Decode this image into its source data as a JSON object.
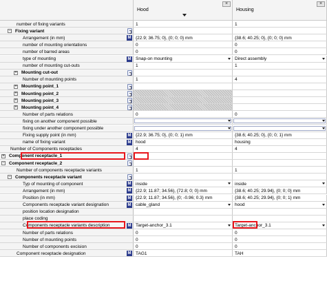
{
  "columns": [
    {
      "title": "Hood",
      "close": "×"
    },
    {
      "title": "Housing",
      "close": "×"
    }
  ],
  "rows": [
    {
      "label": "number of fixing variants",
      "indent": 1,
      "bold": false,
      "toggle": "",
      "icon": "",
      "hood": "1",
      "housing": "1",
      "hood_dd": false,
      "housing_dd": false
    },
    {
      "label": "Fixing variant",
      "indent": 1,
      "bold": true,
      "toggle": "−",
      "icon": "link",
      "hood": "",
      "housing": "",
      "hood_dd": false,
      "housing_dd": false
    },
    {
      "label": "Arrangement (in mm)",
      "indent": 2,
      "bold": false,
      "toggle": "",
      "icon": "M",
      "hood": "{22.9; 36.75; 0}, {0; 0; 0} mm",
      "housing": "{38.6; 40.25; 0}, {0; 0; 0} mm",
      "hood_dd": false,
      "housing_dd": false
    },
    {
      "label": "number of mounting orientations",
      "indent": 2,
      "bold": false,
      "toggle": "",
      "icon": "",
      "hood": "0",
      "housing": "0",
      "hood_dd": false,
      "housing_dd": false
    },
    {
      "label": "number of barred areas",
      "indent": 2,
      "bold": false,
      "toggle": "",
      "icon": "",
      "hood": "0",
      "housing": "0",
      "hood_dd": false,
      "housing_dd": false
    },
    {
      "label": "type of mounting",
      "indent": 2,
      "bold": false,
      "toggle": "",
      "icon": "M",
      "hood": "Snap-on mounting",
      "housing": "Direct assembly",
      "hood_dd": true,
      "housing_dd": true
    },
    {
      "label": "number of mounting cut-outs",
      "indent": 2,
      "bold": false,
      "toggle": "",
      "icon": "",
      "hood": "1",
      "housing": "1",
      "hood_dd": false,
      "housing_dd": false
    },
    {
      "label": "Mounting cut-out",
      "indent": 2,
      "bold": true,
      "toggle": "+",
      "icon": "link",
      "hood": "",
      "housing": "",
      "hood_dd": false,
      "housing_dd": false
    },
    {
      "label": "Number of mounting points",
      "indent": 2,
      "bold": false,
      "toggle": "",
      "icon": "",
      "hood": "1",
      "housing": "4",
      "hood_dd": false,
      "housing_dd": false
    },
    {
      "label": "Mounting point_1",
      "indent": 2,
      "bold": true,
      "toggle": "+",
      "icon": "link",
      "hood": "",
      "housing": "",
      "hood_dd": false,
      "housing_dd": false
    },
    {
      "label": "Mounting point_2",
      "indent": 2,
      "bold": true,
      "toggle": "+",
      "icon": "link",
      "hood": "",
      "housing": "",
      "hood_dd": false,
      "housing_dd": false,
      "hood_hatch": true
    },
    {
      "label": "Mounting point_3",
      "indent": 2,
      "bold": true,
      "toggle": "+",
      "icon": "link",
      "hood": "",
      "housing": "",
      "hood_dd": false,
      "housing_dd": false,
      "hood_hatch": true
    },
    {
      "label": "Mounting point_4",
      "indent": 2,
      "bold": true,
      "toggle": "+",
      "icon": "link",
      "hood": "",
      "housing": "",
      "hood_dd": false,
      "housing_dd": false,
      "hood_hatch": true
    },
    {
      "label": "Number of parts relations",
      "indent": 2,
      "bold": false,
      "toggle": "",
      "icon": "",
      "hood": "0",
      "housing": "0",
      "hood_dd": false,
      "housing_dd": false
    },
    {
      "label": "fixing on another component possible",
      "indent": 2,
      "bold": false,
      "toggle": "",
      "icon": "",
      "hood": "",
      "housing": "",
      "hood_dd": true,
      "housing_dd": true,
      "hood_input": true,
      "housing_input": true
    },
    {
      "label": "fixing under another component possible",
      "indent": 2,
      "bold": false,
      "toggle": "",
      "icon": "",
      "hood": "",
      "housing": "",
      "hood_dd": true,
      "housing_dd": true,
      "hood_input": true,
      "housing_input": true
    },
    {
      "label": "Fixing supply point (in mm)",
      "indent": 2,
      "bold": false,
      "toggle": "",
      "icon": "M",
      "hood": "{22.9; 36.75; 0}, {0; 0; 1} mm",
      "housing": "{38.6; 40.25; 0}, {0; 0; 1} mm",
      "hood_dd": false,
      "housing_dd": false
    },
    {
      "label": "name of fixing variant",
      "indent": 2,
      "bold": false,
      "toggle": "",
      "icon": "M",
      "hood": "hood",
      "housing": "housing",
      "hood_dd": false,
      "housing_dd": false
    },
    {
      "label": "Number of Components receptacles",
      "indent": 0,
      "bold": false,
      "toggle": "",
      "icon": "",
      "hood": "4",
      "housing": "4",
      "hood_dd": false,
      "housing_dd": false
    },
    {
      "label": "Component receptacle_1",
      "indent": 0,
      "bold": true,
      "toggle": "+",
      "icon": "link",
      "hood": "",
      "housing": "",
      "hood_dd": false,
      "housing_dd": false
    },
    {
      "label": "Component receptacle_2",
      "indent": 0,
      "bold": true,
      "toggle": "−",
      "icon": "link",
      "hood": "",
      "housing": "",
      "hood_dd": false,
      "housing_dd": false
    },
    {
      "label": "Number of components receptacle variants",
      "indent": 1,
      "bold": false,
      "toggle": "",
      "icon": "",
      "hood": "1",
      "housing": "1",
      "hood_dd": false,
      "housing_dd": false
    },
    {
      "label": "Components receptacle variant",
      "indent": 1,
      "bold": true,
      "toggle": "−",
      "icon": "link",
      "hood": "",
      "housing": "",
      "hood_dd": false,
      "housing_dd": false
    },
    {
      "label": "Typ of mounting of component",
      "indent": 2,
      "bold": false,
      "toggle": "",
      "icon": "M",
      "hood": "inside",
      "housing": "inside",
      "hood_dd": true,
      "housing_dd": true
    },
    {
      "label": "Arrangement (in mm)",
      "indent": 2,
      "bold": false,
      "toggle": "",
      "icon": "M",
      "hood": "{22.9; 11.87; 34.56}, {72.8; 0; 0} mm",
      "housing": "{38.6; 40.25; 29.94}, {0; 0; 0} mm",
      "hood_dd": false,
      "housing_dd": false
    },
    {
      "label": "Position (in mm)",
      "indent": 2,
      "bold": false,
      "toggle": "",
      "icon": "M",
      "hood": "{22.9; 11.87; 34.56}, {0; -0.96; 0.3} mm",
      "housing": "{38.6; 40.25; 29.94}, {0; 0; 1} mm",
      "hood_dd": false,
      "housing_dd": false
    },
    {
      "label": "Components receptacle variant designation",
      "indent": 2,
      "bold": false,
      "toggle": "",
      "icon": "M",
      "hood": "cable_gland",
      "housing": "hood",
      "hood_dd": true,
      "housing_dd": true
    },
    {
      "label": "position location designation",
      "indent": 2,
      "bold": false,
      "toggle": "",
      "icon": "",
      "hood": "",
      "housing": "",
      "hood_dd": false,
      "housing_dd": false
    },
    {
      "label": "place coding",
      "indent": 2,
      "bold": false,
      "toggle": "",
      "icon": "",
      "hood": "",
      "housing": "",
      "hood_dd": false,
      "housing_dd": false
    },
    {
      "label": "Components receptacle variants description",
      "indent": 2,
      "bold": false,
      "toggle": "",
      "icon": "M",
      "hood": "Target-anchor_3.1",
      "housing": "Target-anchor_3.1",
      "hood_dd": true,
      "housing_dd": true
    },
    {
      "label": "Number of parts relations",
      "indent": 2,
      "bold": false,
      "toggle": "",
      "icon": "",
      "hood": "0",
      "housing": "0",
      "hood_dd": false,
      "housing_dd": false
    },
    {
      "label": "Number of mounting points",
      "indent": 2,
      "bold": false,
      "toggle": "",
      "icon": "",
      "hood": "0",
      "housing": "0",
      "hood_dd": false,
      "housing_dd": false
    },
    {
      "label": "Number of components excision",
      "indent": 2,
      "bold": false,
      "toggle": "",
      "icon": "",
      "hood": "0",
      "housing": "0",
      "hood_dd": false,
      "housing_dd": false
    },
    {
      "label": "Component receptacle designation",
      "indent": 1,
      "bold": false,
      "toggle": "",
      "icon": "M",
      "hood": "TAG1",
      "housing": "TAH",
      "hood_dd": false,
      "housing_dd": false
    }
  ],
  "highlights": {
    "color": "#e8151b"
  }
}
